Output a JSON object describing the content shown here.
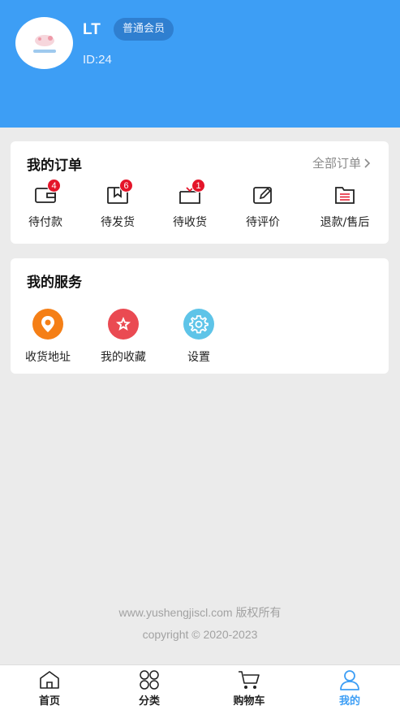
{
  "profile": {
    "username": "LT",
    "member_level": "普通会员",
    "user_id": "ID:24"
  },
  "orders": {
    "title": "我的订单",
    "all_orders_label": "全部订单",
    "items": [
      {
        "label": "待付款",
        "badge": "4",
        "icon": "wallet-icon"
      },
      {
        "label": "待发货",
        "badge": "6",
        "icon": "gift-box-icon"
      },
      {
        "label": "待收货",
        "badge": "1",
        "icon": "receive-box-icon"
      },
      {
        "label": "待评价",
        "badge": null,
        "icon": "edit-review-icon"
      },
      {
        "label": "退款/售后",
        "badge": null,
        "icon": "refund-list-icon"
      }
    ]
  },
  "services": {
    "title": "我的服务",
    "items": [
      {
        "label": "收货地址",
        "icon": "location-pin-icon",
        "color": "#f57f16"
      },
      {
        "label": "我的收藏",
        "icon": "star-icon",
        "color": "#ea4a52"
      },
      {
        "label": "设置",
        "icon": "gear-icon",
        "color": "#5ec4e8"
      }
    ]
  },
  "footer": {
    "line1": "www.yushengjiscl.com 版权所有",
    "line2": "copyright © 2020-2023"
  },
  "tabbar": {
    "items": [
      {
        "label": "首页",
        "icon": "home-icon",
        "active": false
      },
      {
        "label": "分类",
        "icon": "category-grid-icon",
        "active": false
      },
      {
        "label": "购物车",
        "icon": "cart-icon",
        "active": false
      },
      {
        "label": "我的",
        "icon": "user-icon",
        "active": true
      }
    ]
  },
  "colors": {
    "primary": "#3d9ef5",
    "badge_red": "#e4152a",
    "background": "#ebebeb"
  }
}
